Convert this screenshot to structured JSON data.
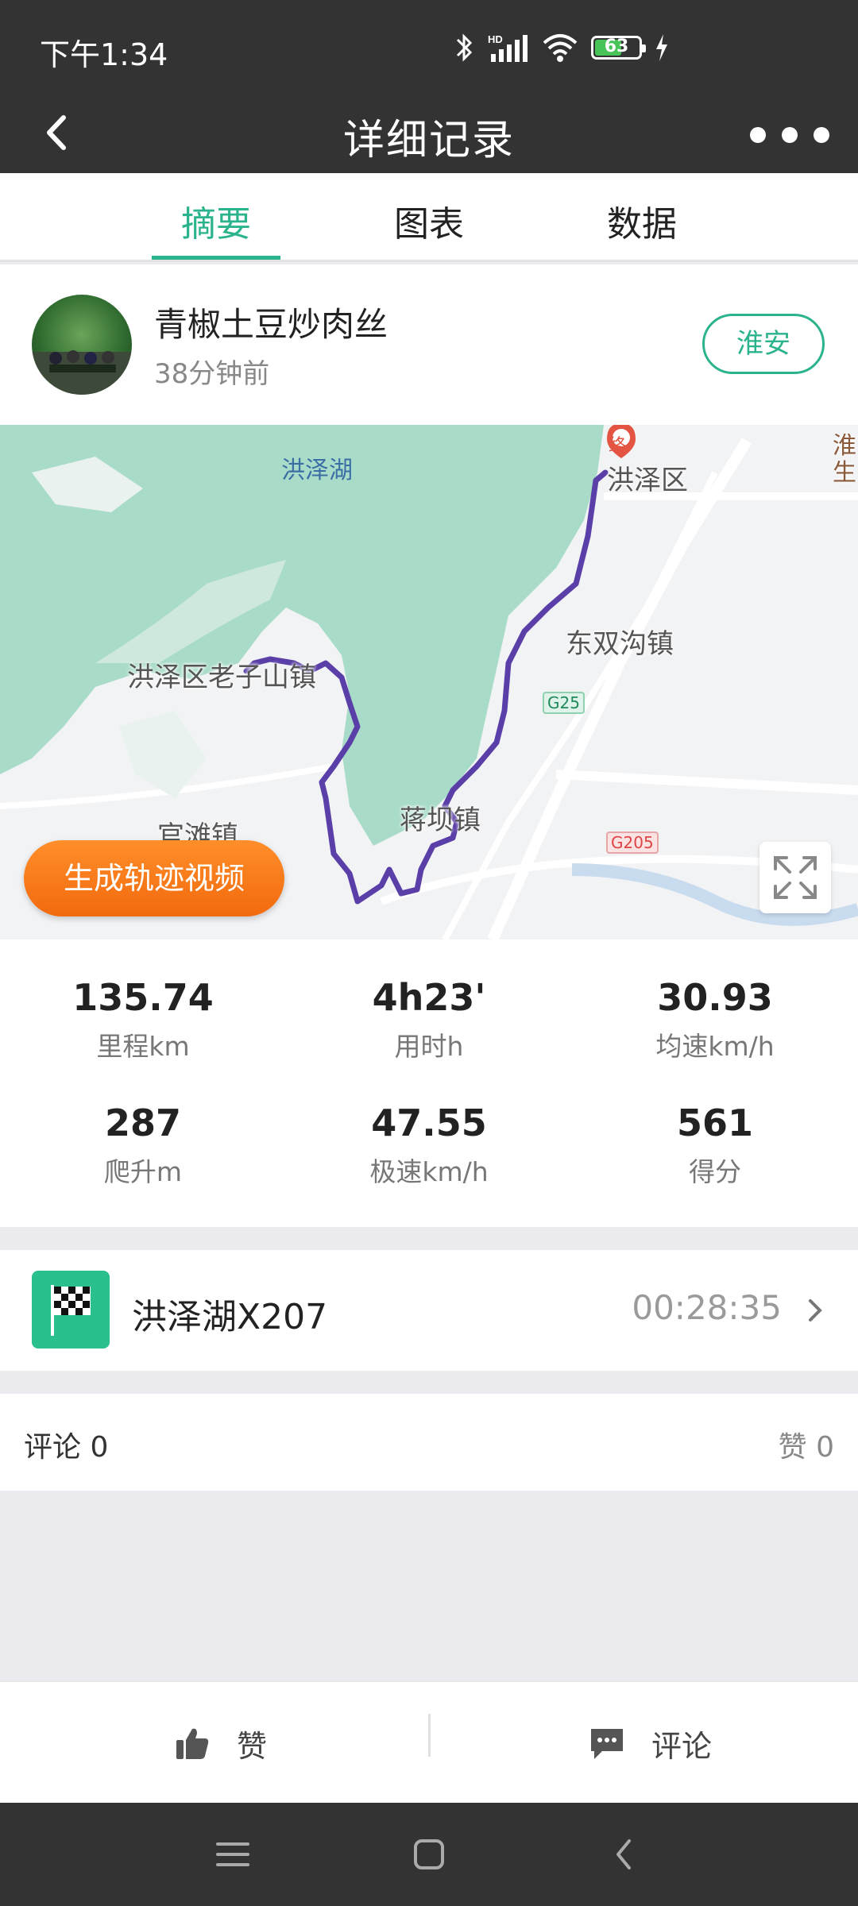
{
  "status_bar": {
    "time": "下午1:34",
    "battery_level": "63",
    "battery_fraction": 0.63
  },
  "nav": {
    "title": "详细记录",
    "back_icon": "back-chevron-icon",
    "more_icon": "more-dots-icon"
  },
  "tabs": [
    {
      "label": "摘要",
      "active": true
    },
    {
      "label": "图表",
      "active": false
    },
    {
      "label": "数据",
      "active": false
    }
  ],
  "user": {
    "name": "青椒土豆炒肉丝",
    "time_ago": "38分钟前",
    "city": "淮安"
  },
  "map": {
    "labels": {
      "lake": "洪泽湖",
      "district": "洪泽区",
      "town1": "洪泽区老子山镇",
      "town2": "东双沟镇",
      "town3": "官滩镇",
      "town4": "蒋坝镇",
      "corner": "淮生",
      "road1": "G25",
      "road2": "G205",
      "end_marker": "终"
    },
    "generate_video_label": "生成轨迹视频",
    "expand_icon": "expand-icon",
    "route_color": "#5b3fa8",
    "lake_color": "#a9dcc8"
  },
  "stats": [
    {
      "value": "135.74",
      "label": "里程km"
    },
    {
      "value": "4h23'",
      "label": "用时h"
    },
    {
      "value": "30.93",
      "label": "均速km/h"
    },
    {
      "value": "287",
      "label": "爬升m"
    },
    {
      "value": "47.55",
      "label": "极速km/h"
    },
    {
      "value": "561",
      "label": "得分"
    }
  ],
  "segment": {
    "name": "洪泽湖X207",
    "time": "00:28:35",
    "icon": "checkered-flag-icon"
  },
  "comments": {
    "comment_text": "评论 0",
    "like_text": "赞 0"
  },
  "actions": {
    "like_label": "赞",
    "comment_label": "评论"
  },
  "colors": {
    "accent": "#2ab38c",
    "header_bg": "#333333",
    "orange": "#f57a17"
  }
}
